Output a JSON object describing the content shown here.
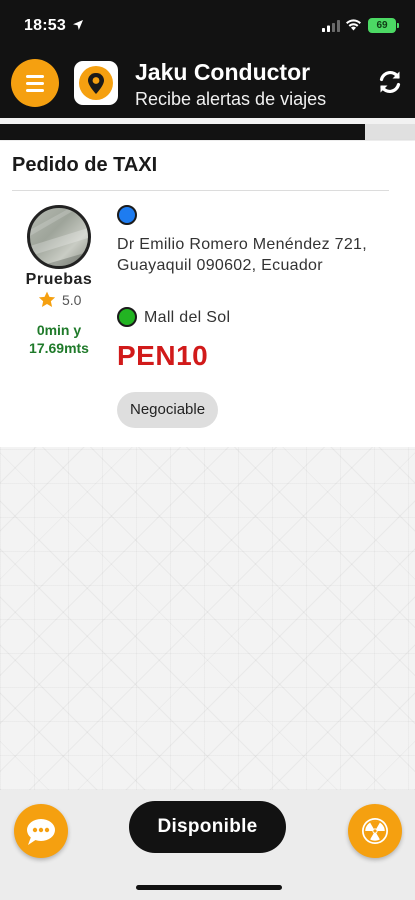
{
  "status_bar": {
    "time": "18:53",
    "battery": "69"
  },
  "header": {
    "title": "Jaku Conductor",
    "subtitle": "Recibe alertas de viajes",
    "menu_icon": "hamburger-menu-icon",
    "refresh_icon": "refresh-icon"
  },
  "progress": {
    "fraction": 0.88
  },
  "order": {
    "title": "Pedido de TAXI",
    "passenger": {
      "name": "Pruebas",
      "rating": "5.0",
      "eta_line1": "0min y",
      "eta_line2": "17.69mts"
    },
    "origin_address": "Dr Emilio Romero Menéndez 721, Guayaquil 090602, Ecuador",
    "destination": "Mall del Sol",
    "price": "PEN10",
    "negotiable_label": "Negociable"
  },
  "bottom_bar": {
    "status_label": "Disponible",
    "chat_icon": "chat-bubble-icon",
    "sos_icon": "radiation-icon"
  },
  "colors": {
    "accent": "#f5a010",
    "header_bg": "#121212",
    "price": "#d11a1a",
    "eta": "#1f7a2a",
    "origin_dot": "#1e7cf0",
    "destination_dot": "#22b322"
  }
}
